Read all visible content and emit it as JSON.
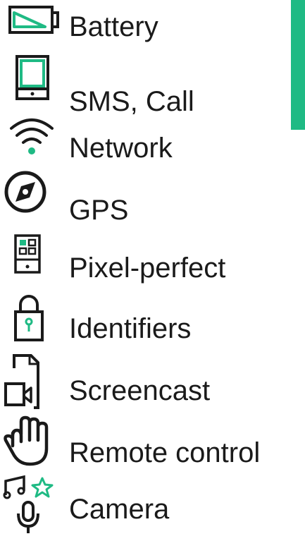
{
  "accent_color": "#1fba84",
  "menu": {
    "items": [
      {
        "label": "Battery",
        "icon": "battery-icon"
      },
      {
        "label": "SMS, Call",
        "icon": "phone-icon"
      },
      {
        "label": "Network",
        "icon": "wifi-icon"
      },
      {
        "label": "GPS",
        "icon": "compass-icon"
      },
      {
        "label": "Pixel-perfect",
        "icon": "pixel-grid-icon"
      },
      {
        "label": "Identifiers",
        "icon": "lock-icon"
      },
      {
        "label": "Screencast",
        "icon": "screencast-icon"
      },
      {
        "label": "Remote control",
        "icon": "hand-icon"
      },
      {
        "label": "Camera",
        "icon": "camera-media-icon"
      }
    ]
  }
}
